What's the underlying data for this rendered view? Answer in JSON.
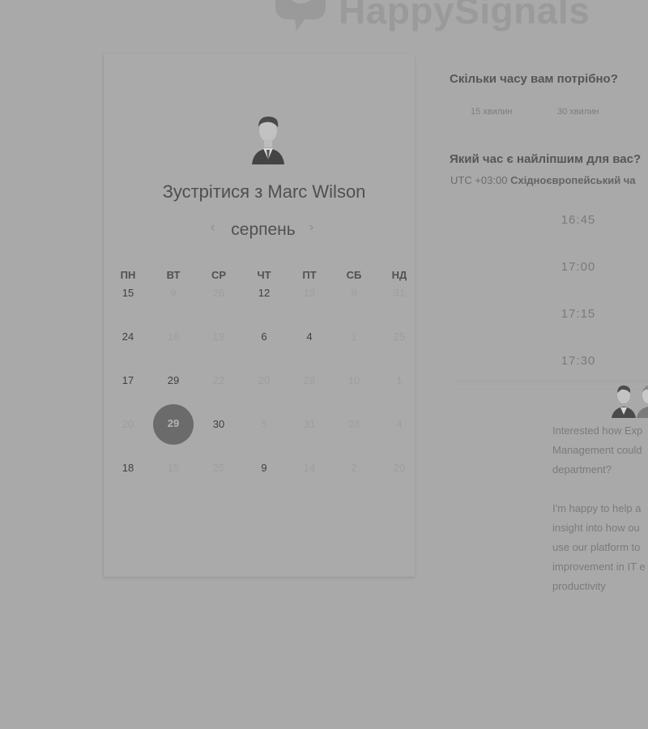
{
  "brand": {
    "name": "HappySignals"
  },
  "booking": {
    "title_prefix": "Зустрітися з",
    "host": "Marc Wilson",
    "month": "серпень",
    "weekdays": [
      "ПН",
      "ВТ",
      "СР",
      "ЧТ",
      "ПТ",
      "СБ",
      "НД"
    ],
    "weeks": [
      [
        {
          "d": "15",
          "s": "active"
        },
        {
          "d": "9",
          "s": "inactive"
        },
        {
          "d": "26",
          "s": "inactive"
        },
        {
          "d": "12",
          "s": "active"
        },
        {
          "d": "13",
          "s": "inactive"
        },
        {
          "d": "9",
          "s": "inactive"
        },
        {
          "d": "31",
          "s": "inactive"
        }
      ],
      [
        {
          "d": "24",
          "s": "active"
        },
        {
          "d": "16",
          "s": "inactive"
        },
        {
          "d": "19",
          "s": "inactive"
        },
        {
          "d": "6",
          "s": "active"
        },
        {
          "d": "4",
          "s": "active"
        },
        {
          "d": "1",
          "s": "inactive"
        },
        {
          "d": "25",
          "s": "inactive"
        }
      ],
      [
        {
          "d": "17",
          "s": "active"
        },
        {
          "d": "29",
          "s": "active"
        },
        {
          "d": "22",
          "s": "inactive"
        },
        {
          "d": "20",
          "s": "inactive"
        },
        {
          "d": "28",
          "s": "inactive"
        },
        {
          "d": "10",
          "s": "inactive"
        },
        {
          "d": "1",
          "s": "inactive"
        }
      ],
      [
        {
          "d": "20",
          "s": "inactive"
        },
        {
          "d": "29",
          "s": "selected"
        },
        {
          "d": "30",
          "s": "active"
        },
        {
          "d": "5",
          "s": "inactive"
        },
        {
          "d": "31",
          "s": "inactive"
        },
        {
          "d": "28",
          "s": "inactive"
        },
        {
          "d": "4",
          "s": "inactive"
        }
      ],
      [
        {
          "d": "18",
          "s": "active"
        },
        {
          "d": "15",
          "s": "inactive"
        },
        {
          "d": "25",
          "s": "inactive"
        },
        {
          "d": "9",
          "s": "active"
        },
        {
          "d": "14",
          "s": "inactive"
        },
        {
          "d": "2",
          "s": "inactive"
        },
        {
          "d": "20",
          "s": "inactive"
        }
      ]
    ]
  },
  "duration": {
    "question": "Скільки часу вам потрібно?",
    "options": [
      "15 хвилин",
      "30 хвилин"
    ]
  },
  "time": {
    "question": "Який час є найліпшим для вас?",
    "tz_offset": "UTC +03:00",
    "tz_name": "Східноєвропейський ча",
    "slots": [
      "16:45",
      "17:00",
      "17:15",
      "17:30"
    ]
  },
  "message": {
    "lines": [
      "Interested how Exp",
      "Management could",
      "department?",
      "",
      "I'm happy to help a",
      "insight into how ou",
      "use our platform to",
      "improvement in IT e",
      "productivity"
    ]
  },
  "colors": {
    "background": "#a9a9a9",
    "selected_day": "#6b6b6b"
  }
}
